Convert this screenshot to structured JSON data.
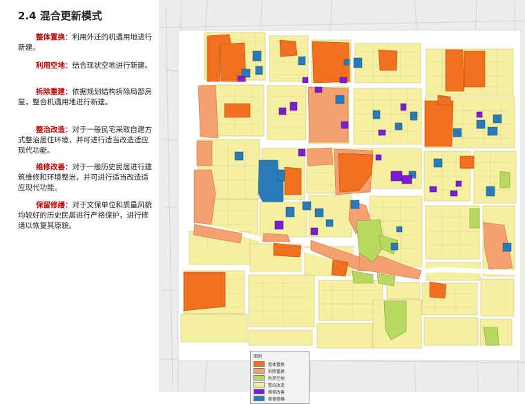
{
  "title": "2.4 混合更新模式",
  "descriptions": [
    {
      "term": "整体置换",
      "text": "：利用外迁的机遇用地进行新建。"
    },
    {
      "term": "利用空地",
      "text": "：结合现状空地进行新建。"
    },
    {
      "term": "拆除重建",
      "text": "：依据规划结构拆除局部房屋，整合机遇用地进行新建。"
    },
    {
      "term": "整治改造",
      "text": "：对于一般民宅采取自建方式整治居住环境，并可进行适当改造适应现代功能。"
    },
    {
      "term": "维修改善",
      "text": "：对于一般历史民居进行建筑维修和环境整治，并可进行适当改造适应现代功能。"
    },
    {
      "term": "保留修缮",
      "text": "：对于文保单位和质量风貌均较好的历史民居进行严格保护，进行修缮以恢复其原貌。"
    }
  ],
  "legend": {
    "title": "图例",
    "items": [
      {
        "label": "整体置换",
        "color": "#f07020"
      },
      {
        "label": "拆除重建",
        "color": "#f4a070"
      },
      {
        "label": "利用空地",
        "color": "#b8d860"
      },
      {
        "label": "整治改造",
        "color": "#f5f0a0"
      },
      {
        "label": "维修改善",
        "color": "#7a1fd0"
      },
      {
        "label": "保留修缮",
        "color": "#2a7ab8"
      }
    ]
  },
  "colors": {
    "background": "#ffffff",
    "term_red": "#c00000",
    "yellow": "#f5f0a0",
    "orange": "#f07020",
    "light_orange": "#f4a070",
    "green": "#b8d860",
    "purple": "#7a1fd0",
    "blue": "#2a7ab8",
    "road": "#ffffff",
    "context": "#e8e8e8"
  }
}
